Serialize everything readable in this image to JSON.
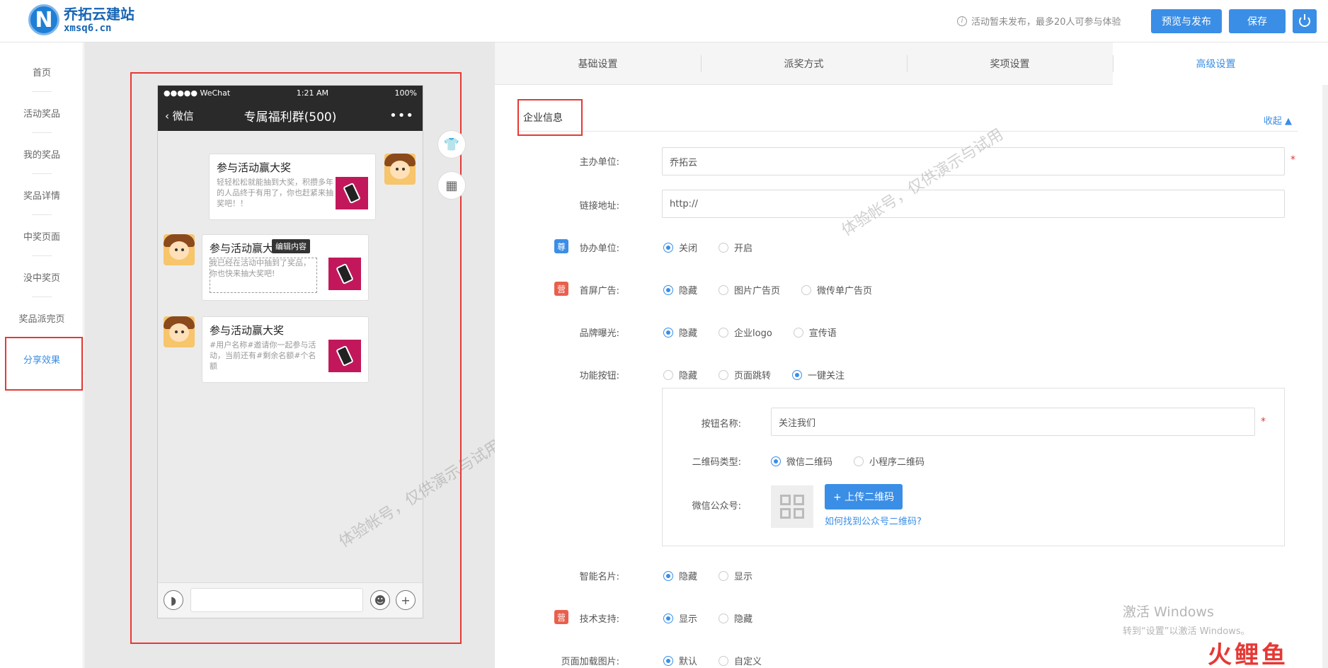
{
  "header": {
    "logo_letter": "N",
    "logo_name": "乔拓云建站",
    "logo_domain": "xmsq6.cn",
    "notice": "活动暂未发布，最多20人可参与体验",
    "preview_button": "预览与发布",
    "save_button": "保存"
  },
  "sidebar": {
    "items": [
      {
        "label": "首页"
      },
      {
        "label": "活动奖品"
      },
      {
        "label": "我的奖品"
      },
      {
        "label": "奖品详情"
      },
      {
        "label": "中奖页面"
      },
      {
        "label": "没中奖页"
      },
      {
        "label": "奖品派完页"
      },
      {
        "label": "分享效果"
      }
    ],
    "collapse_symbol": "«"
  },
  "phone": {
    "status_left": "●●●●● WeChat",
    "status_time": "1:21 AM",
    "status_battery": "100%",
    "back_label": "微信",
    "chat_title": "专属福利群(500)",
    "more": "•••",
    "messages": [
      {
        "title": "参与活动赢大奖",
        "body": "轻轻松松就能抽到大奖，积攒多年的人品终于有用了，你也赶紧来抽奖吧！！"
      },
      {
        "title": "参与活动赢大奖",
        "body": "我已经在活动中抽到了奖品，你也快来抽大奖吧!"
      },
      {
        "title": "参与活动赢大奖",
        "body": "#用户名称#邀请你一起参与活动，当前还有#剩余名额#个名额"
      }
    ],
    "edit_tooltip": "编辑内容"
  },
  "watermark": "体验帐号，仅供演示与试用",
  "tabs": [
    {
      "label": "基础设置"
    },
    {
      "label": "派奖方式"
    },
    {
      "label": "奖项设置"
    },
    {
      "label": "高级设置"
    }
  ],
  "section": {
    "title": "企业信息",
    "collapse_label": "收起 ▲"
  },
  "form": {
    "host_label": "主办单位:",
    "host_value": "乔拓云",
    "link_label": "链接地址:",
    "link_value": "http://",
    "co_label": "协办单位:",
    "co_badge": "尊",
    "co_options": [
      "关闭",
      "开启"
    ],
    "ad_label": "首屏广告:",
    "ad_badge": "营",
    "ad_options": [
      "隐藏",
      "图片广告页",
      "微传单广告页"
    ],
    "brand_label": "品牌曝光:",
    "brand_options": [
      "隐藏",
      "企业logo",
      "宣传语"
    ],
    "func_label": "功能按钮:",
    "func_options": [
      "隐藏",
      "页面跳转",
      "一键关注"
    ],
    "button_name_label": "按钮名称:",
    "button_name_value": "关注我们",
    "qr_type_label": "二维码类型:",
    "qr_type_options": [
      "微信二维码",
      "小程序二维码"
    ],
    "wechat_label": "微信公众号:",
    "upload_label": "+ 上传二维码",
    "help_link": "如何找到公众号二维码?",
    "card_label": "智能名片:",
    "card_options": [
      "隐藏",
      "显示"
    ],
    "tech_label": "技术支持:",
    "tech_badge": "营",
    "tech_options": [
      "显示",
      "隐藏"
    ],
    "loading_label": "页面加载图片:",
    "loading_options": [
      "默认",
      "自定义"
    ]
  },
  "windows": {
    "title": "激活 Windows",
    "subtitle": "转到“设置”以激活 Windows。"
  },
  "brand_mark": "火鲤鱼"
}
